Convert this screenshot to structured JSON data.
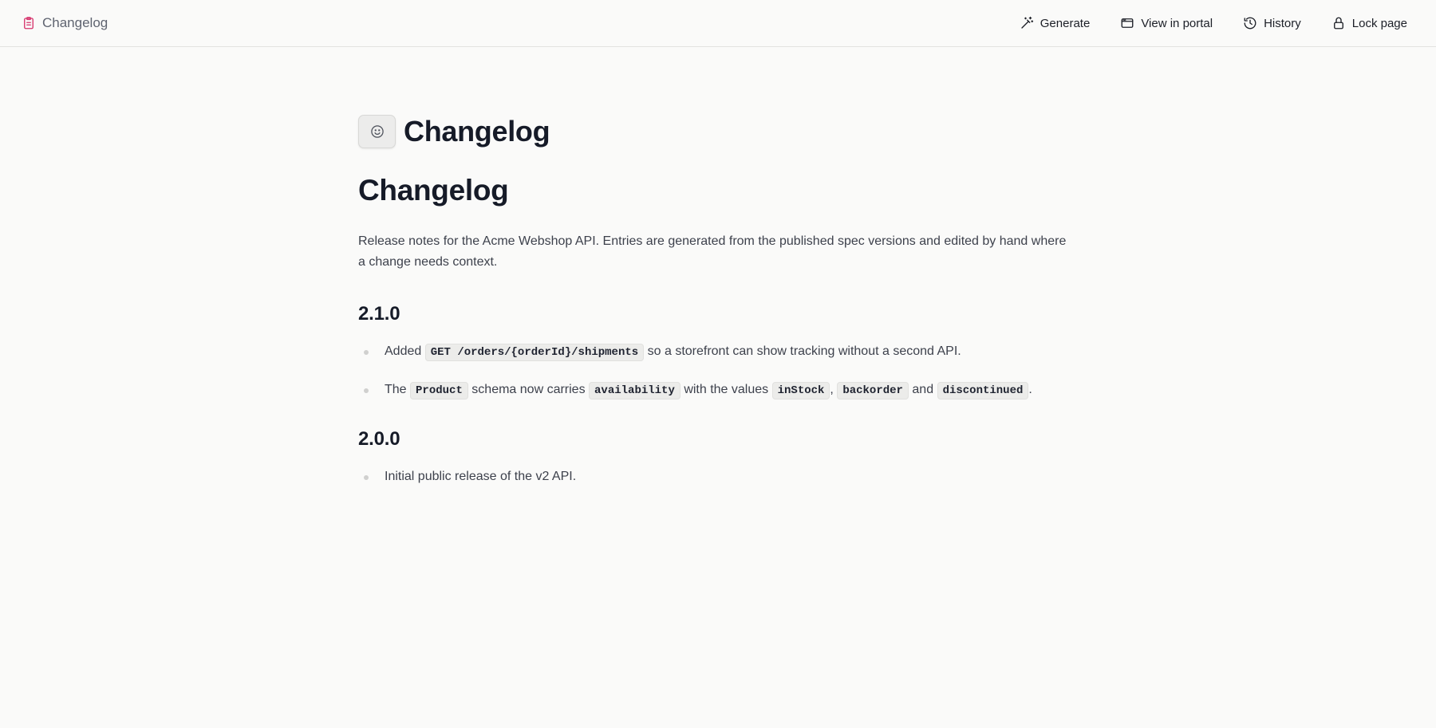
{
  "topbar": {
    "breadcrumb_label": "Changelog",
    "breadcrumb_icon": "clipboard-icon",
    "accent_color": "#d6336c",
    "actions": {
      "generate": "Generate",
      "view_in_portal": "View in portal",
      "history": "History",
      "lock_page": "Lock page"
    }
  },
  "page": {
    "emoji_icon": "smiley-icon",
    "title": "Changelog",
    "heading": "Changelog",
    "intro": "Release notes for the Acme Webshop API. Entries are generated from the published spec versions and edited by hand where a change needs context."
  },
  "versions": [
    {
      "version": "2.1.0",
      "entries": [
        {
          "t0": "Added",
          "c0": "GET /orders/{orderId}/shipments",
          "t1": "so a storefront can show tracking without a second API."
        },
        {
          "t0": "The",
          "c0": "Product",
          "t1": "schema now carries",
          "c1": "availability",
          "t2": "with the values",
          "c2": "inStock",
          "t3": ",",
          "c3": "backorder",
          "t4": "and",
          "c4": "discontinued",
          "t5": "."
        }
      ]
    },
    {
      "version": "2.0.0",
      "entries": [
        {
          "t0": "Initial public release of the v2 API."
        }
      ]
    }
  ]
}
